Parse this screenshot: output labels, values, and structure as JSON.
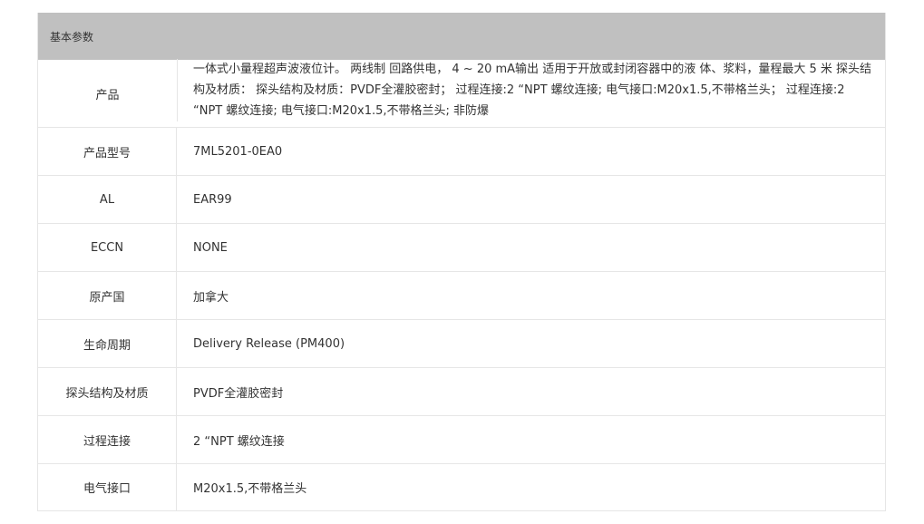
{
  "table": {
    "header": "基本参数",
    "rows": [
      {
        "label": "产品",
        "value": "一体式小量程超声波液位计。 两线制 回路供电， 4 ~ 20 mA输出 适用于开放或封闭容器中的液 体、浆料，量程最大 5 米 探头结构及材质： 探头结构及材质：PVDF全灌胶密封； 过程连接:2  “NPT 螺纹连接; 电气接口:M20x1.5,不带格兰头； 过程连接:2  “NPT 螺纹连接; 电气接口:M20x1.5,不带格兰头; 非防爆"
      },
      {
        "label": "产品型号",
        "value": "7ML5201-0EA0"
      },
      {
        "label": "AL",
        "value": "EAR99"
      },
      {
        "label": "ECCN",
        "value": "NONE"
      },
      {
        "label": "原产国",
        "value": "加拿大"
      },
      {
        "label": "生命周期",
        "value": "Delivery Release (PM400)"
      },
      {
        "label": "探头结构及材质",
        "value": "PVDF全灌胶密封"
      },
      {
        "label": "过程连接",
        "value": "2  “NPT 螺纹连接"
      },
      {
        "label": "电气接口",
        "value": "M20x1.5,不带格兰头"
      }
    ]
  }
}
